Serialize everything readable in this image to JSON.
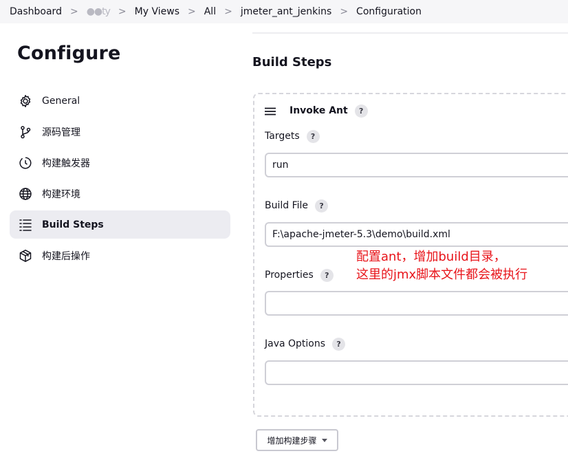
{
  "breadcrumb": {
    "items": [
      "Dashboard",
      "●●ty",
      "My Views",
      "All",
      "jmeter_ant_jenkins",
      "Configuration"
    ],
    "separator": ">"
  },
  "sidebar": {
    "title": "Configure",
    "items": [
      {
        "label": "General",
        "icon": "gear-icon"
      },
      {
        "label": "源码管理",
        "icon": "source-branch-icon"
      },
      {
        "label": "构建触发器",
        "icon": "timer-icon"
      },
      {
        "label": "构建环境",
        "icon": "globe-icon"
      },
      {
        "label": "Build Steps",
        "icon": "list-icon",
        "active": true
      },
      {
        "label": "构建后操作",
        "icon": "package-icon"
      }
    ]
  },
  "main": {
    "section_title": "Build Steps",
    "step": {
      "title": "Invoke Ant",
      "help": "?",
      "fields": {
        "targets": {
          "label": "Targets",
          "value": "run"
        },
        "build_file": {
          "label": "Build File",
          "value": "F:\\apache-jmeter-5.3\\demo\\build.xml"
        },
        "properties": {
          "label": "Properties",
          "value": ""
        },
        "java_options": {
          "label": "Java Options",
          "value": ""
        }
      }
    },
    "annotation": {
      "line1": "配置ant，增加build目录，",
      "line2": "这里的jmx脚本文件都会被执行",
      "color": "#e8141a"
    },
    "add_step_button": "增加构建步骤"
  }
}
